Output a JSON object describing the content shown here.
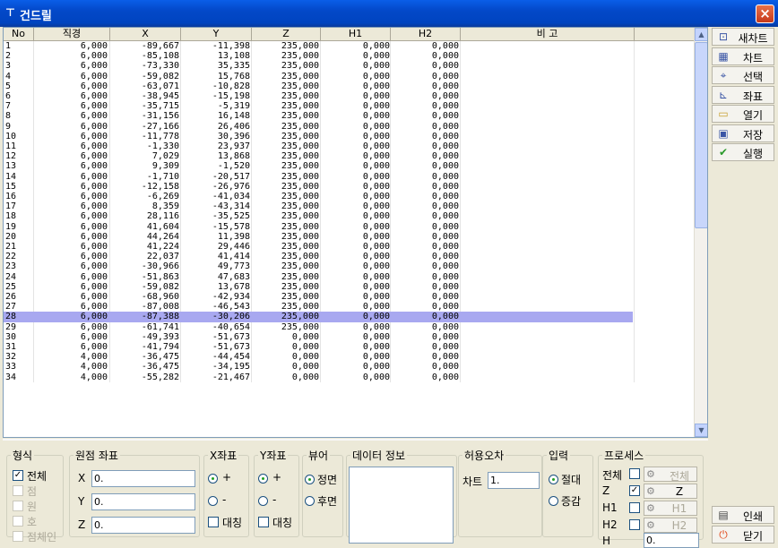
{
  "window": {
    "title": "건드릴",
    "close": "×"
  },
  "columns": [
    "No",
    "직경",
    "X",
    "Y",
    "Z",
    "H1",
    "H2",
    "비 고"
  ],
  "rows": [
    [
      "1",
      "6,000",
      "-89,667",
      "-11,398",
      "235,000",
      "0,000",
      "0,000"
    ],
    [
      "2",
      "6,000",
      "-85,108",
      "13,108",
      "235,000",
      "0,000",
      "0,000"
    ],
    [
      "3",
      "6,000",
      "-73,330",
      "35,335",
      "235,000",
      "0,000",
      "0,000"
    ],
    [
      "4",
      "6,000",
      "-59,082",
      "15,768",
      "235,000",
      "0,000",
      "0,000"
    ],
    [
      "5",
      "6,000",
      "-63,071",
      "-10,828",
      "235,000",
      "0,000",
      "0,000"
    ],
    [
      "6",
      "6,000",
      "-38,945",
      "-15,198",
      "235,000",
      "0,000",
      "0,000"
    ],
    [
      "7",
      "6,000",
      "-35,715",
      "-5,319",
      "235,000",
      "0,000",
      "0,000"
    ],
    [
      "8",
      "6,000",
      "-31,156",
      "16,148",
      "235,000",
      "0,000",
      "0,000"
    ],
    [
      "9",
      "6,000",
      "-27,166",
      "26,406",
      "235,000",
      "0,000",
      "0,000"
    ],
    [
      "10",
      "6,000",
      "-11,778",
      "30,396",
      "235,000",
      "0,000",
      "0,000"
    ],
    [
      "11",
      "6,000",
      "-1,330",
      "23,937",
      "235,000",
      "0,000",
      "0,000"
    ],
    [
      "12",
      "6,000",
      "7,029",
      "13,868",
      "235,000",
      "0,000",
      "0,000"
    ],
    [
      "13",
      "6,000",
      "9,309",
      "-1,520",
      "235,000",
      "0,000",
      "0,000"
    ],
    [
      "14",
      "6,000",
      "-1,710",
      "-20,517",
      "235,000",
      "0,000",
      "0,000"
    ],
    [
      "15",
      "6,000",
      "-12,158",
      "-26,976",
      "235,000",
      "0,000",
      "0,000"
    ],
    [
      "16",
      "6,000",
      "-6,269",
      "-41,034",
      "235,000",
      "0,000",
      "0,000"
    ],
    [
      "17",
      "6,000",
      "8,359",
      "-43,314",
      "235,000",
      "0,000",
      "0,000"
    ],
    [
      "18",
      "6,000",
      "28,116",
      "-35,525",
      "235,000",
      "0,000",
      "0,000"
    ],
    [
      "19",
      "6,000",
      "41,604",
      "-15,578",
      "235,000",
      "0,000",
      "0,000"
    ],
    [
      "20",
      "6,000",
      "44,264",
      "11,398",
      "235,000",
      "0,000",
      "0,000"
    ],
    [
      "21",
      "6,000",
      "41,224",
      "29,446",
      "235,000",
      "0,000",
      "0,000"
    ],
    [
      "22",
      "6,000",
      "22,037",
      "41,414",
      "235,000",
      "0,000",
      "0,000"
    ],
    [
      "23",
      "6,000",
      "-30,966",
      "49,773",
      "235,000",
      "0,000",
      "0,000"
    ],
    [
      "24",
      "6,000",
      "-51,863",
      "47,683",
      "235,000",
      "0,000",
      "0,000"
    ],
    [
      "25",
      "6,000",
      "-59,082",
      "13,678",
      "235,000",
      "0,000",
      "0,000"
    ],
    [
      "26",
      "6,000",
      "-68,960",
      "-42,934",
      "235,000",
      "0,000",
      "0,000"
    ],
    [
      "27",
      "6,000",
      "-87,008",
      "-46,543",
      "235,000",
      "0,000",
      "0,000"
    ],
    [
      "28",
      "6,000",
      "-87,388",
      "-30,206",
      "235,000",
      "0,000",
      "0,000"
    ],
    [
      "29",
      "6,000",
      "-61,741",
      "-40,654",
      "235,000",
      "0,000",
      "0,000"
    ],
    [
      "30",
      "6,000",
      "-49,393",
      "-51,673",
      "0,000",
      "0,000",
      "0,000"
    ],
    [
      "31",
      "6,000",
      "-41,794",
      "-51,673",
      "0,000",
      "0,000",
      "0,000"
    ],
    [
      "32",
      "4,000",
      "-36,475",
      "-44,454",
      "0,000",
      "0,000",
      "0,000"
    ],
    [
      "33",
      "4,000",
      "-36,475",
      "-34,195",
      "0,000",
      "0,000",
      "0,000"
    ],
    [
      "34",
      "4,000",
      "-55,282",
      "-21,467",
      "0,000",
      "0,000",
      "0,000"
    ]
  ],
  "selected_row": "28",
  "side_buttons": [
    {
      "label": "새차트",
      "icon": "new-chart-icon"
    },
    {
      "label": "차트",
      "icon": "chart-icon"
    },
    {
      "label": "선택",
      "icon": "select-icon"
    },
    {
      "label": "좌표",
      "icon": "coordinate-icon"
    },
    {
      "label": "열기",
      "icon": "folder-icon"
    },
    {
      "label": "저장",
      "icon": "save-icon"
    },
    {
      "label": "실행",
      "icon": "checkmark-icon"
    }
  ],
  "bottom_buttons": {
    "print": "인쇄",
    "close": "닫기"
  },
  "shape": {
    "legend": "형식",
    "options": [
      "전체",
      "점",
      "원",
      "호",
      "점체인"
    ],
    "checked": "전체"
  },
  "origin": {
    "legend": "원점 좌표",
    "x_label": "X",
    "y_label": "Y",
    "z_label": "Z",
    "x": "0.",
    "y": "0.",
    "z": "0."
  },
  "xaxis": {
    "legend": "X좌표",
    "plus": "+",
    "minus": "-",
    "mirror": "대칭"
  },
  "yaxis": {
    "legend": "Y좌표",
    "plus": "+",
    "minus": "-",
    "mirror": "대칭"
  },
  "view": {
    "legend": "뷰어",
    "front": "정면",
    "back": "후면"
  },
  "datainfo": {
    "legend": "데이터 정보"
  },
  "tolerance": {
    "legend": "허용오차",
    "label": "차트",
    "value": "1."
  },
  "input": {
    "legend": "입력",
    "absolute": "절대",
    "incremental": "증감"
  },
  "process": {
    "legend": "프로세스",
    "rows": [
      {
        "label": "전체",
        "button": "전체",
        "checked": false
      },
      {
        "label": "Z",
        "button": "Z",
        "checked": true
      },
      {
        "label": "H1",
        "button": "H1",
        "checked": false
      },
      {
        "label": "H2",
        "button": "H2",
        "checked": false
      }
    ],
    "h_label": "H",
    "h_value": "0."
  }
}
